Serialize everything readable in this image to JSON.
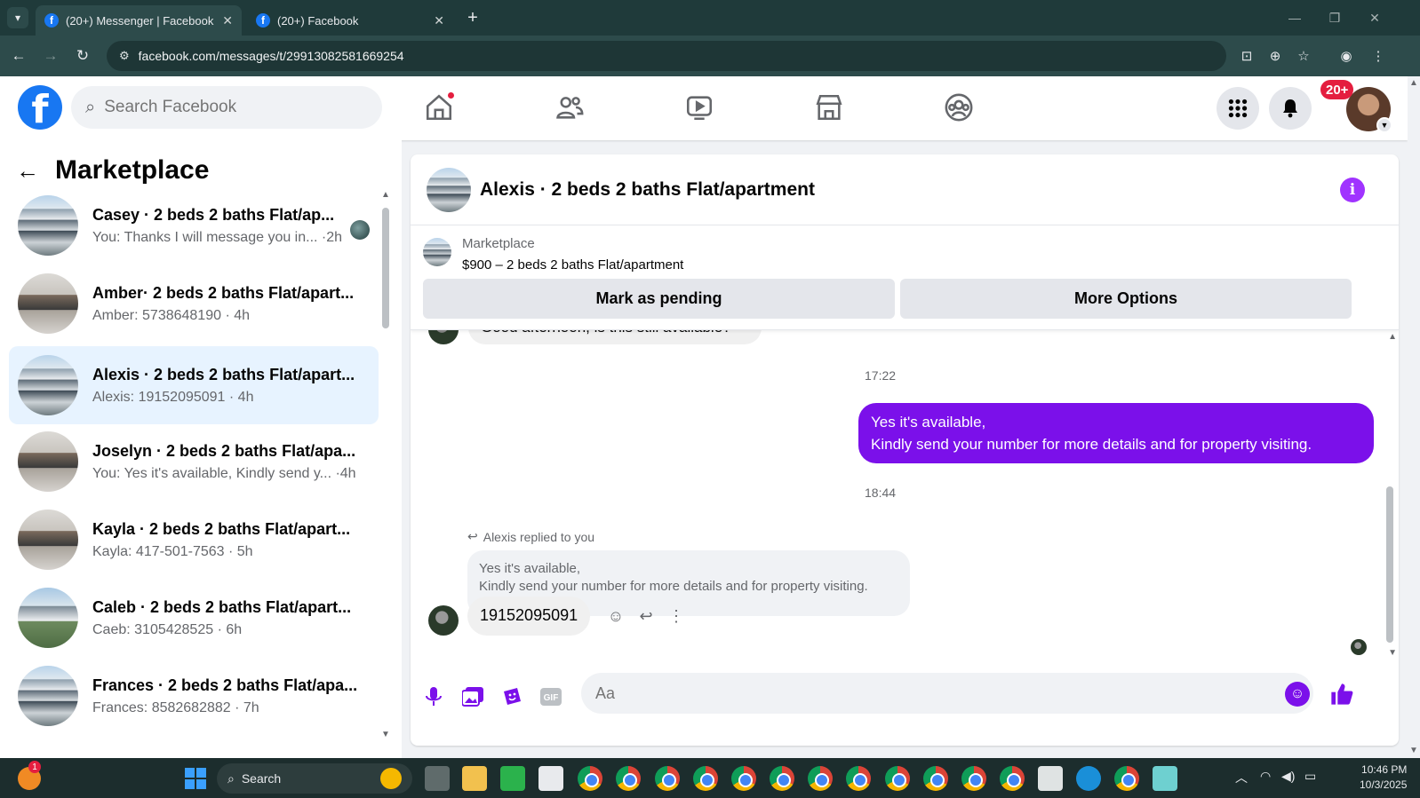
{
  "browser": {
    "tabs": [
      {
        "title": "(20+) Messenger | Facebook",
        "active": true
      },
      {
        "title": "(20+) Facebook",
        "active": false
      }
    ],
    "url": "facebook.com/messages/t/29913082581669254"
  },
  "header": {
    "search_placeholder": "Search Facebook",
    "notification_badge": "20+"
  },
  "sidebar": {
    "title": "Marketplace",
    "conversations": [
      {
        "name": "Casey · 2 beds 2 baths Flat/ap...",
        "preview": "You: Thanks I will message you in... ·2h",
        "thumb": "bldg",
        "selected": false
      },
      {
        "name": "Amber· 2 beds 2 baths Flat/apart...",
        "preview": "Amber: 5738648190 · 4h",
        "thumb": "room",
        "selected": false
      },
      {
        "name": "Alexis · 2 beds 2 baths Flat/apart...",
        "preview": "Alexis: 19152095091 · 4h",
        "thumb": "bldg",
        "selected": true
      },
      {
        "name": "Joselyn · 2 beds 2 baths Flat/apa...",
        "preview": "You: Yes it's available, Kindly send y...  ·4h",
        "thumb": "room",
        "selected": false
      },
      {
        "name": "Kayla · 2 beds 2 baths Flat/apart...",
        "preview": "Kayla: 417-501-7563 · 5h",
        "thumb": "room",
        "selected": false
      },
      {
        "name": "Caleb · 2 beds 2 baths Flat/apart...",
        "preview": "Caeb: 3105428525 · 6h",
        "thumb": "houses",
        "selected": false
      },
      {
        "name": "Frances · 2 beds 2 baths Flat/apa...",
        "preview": "Frances: 8582682882 · 7h",
        "thumb": "bldg",
        "selected": false
      }
    ]
  },
  "chat": {
    "title": "Alexis · 2 beds 2 baths Flat/apartment",
    "listing": {
      "source": "Marketplace",
      "title": "$900 – 2 beds 2 baths Flat/apartment",
      "btn_pending": "Mark as pending",
      "btn_more": "More Options"
    },
    "cut_message": "Good afternoon, is this still available?",
    "time1": "17:22",
    "outgoing": {
      "line1": "Yes it's available,",
      "line2": "Kindly send your number for more details and for property visiting."
    },
    "time2": "18:44",
    "reply_label": "Alexis replied to you",
    "quoted": {
      "line1": "Yes it's available,",
      "line2": "Kindly send your number for more details and for property visiting."
    },
    "incoming": "19152095091",
    "composer_placeholder": "Aa"
  },
  "taskbar": {
    "search": "Search",
    "time": "10:46 PM",
    "date": "10/3/2025",
    "weather_badge": "1"
  },
  "colors": {
    "accent": "#7b10ea",
    "fb_blue": "#1877f2",
    "selected_row": "#e7f3ff"
  }
}
